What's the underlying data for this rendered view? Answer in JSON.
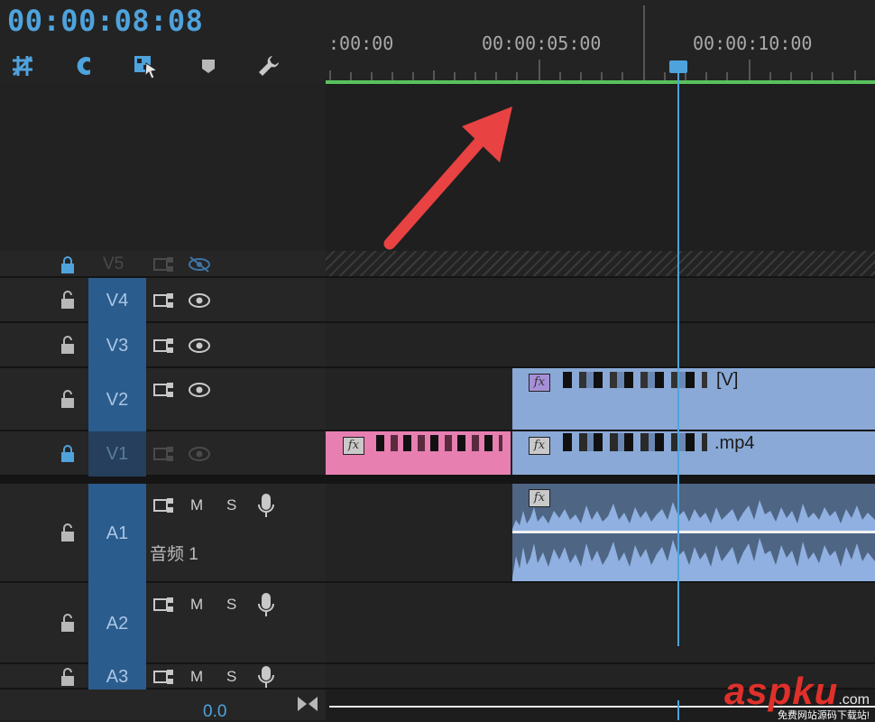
{
  "header": {
    "timecode": "00:00:08:08",
    "tools": [
      "snap-sequence-icon",
      "magnet-icon",
      "linked-selection-icon",
      "marker-icon",
      "wrench-icon"
    ]
  },
  "ruler": {
    "labels": [
      ":00:00",
      "00:00:05:00",
      "00:00:10:00"
    ]
  },
  "tracks": {
    "v5": {
      "label": "V5"
    },
    "v4": {
      "label": "V4"
    },
    "v3": {
      "label": "V3"
    },
    "v2": {
      "label": "V2"
    },
    "v1": {
      "label": "V1"
    },
    "a1": {
      "label": "A1",
      "name": "音频 1",
      "m": "M",
      "s": "S"
    },
    "a2": {
      "label": "A2",
      "m": "M",
      "s": "S"
    },
    "a3": {
      "label": "A3",
      "m": "M",
      "s": "S"
    }
  },
  "clips": {
    "v2_clip_suffix": "[V]",
    "v1_clip_suffix": ".mp4",
    "fx": "fx"
  },
  "footer": {
    "volume": "0.0"
  },
  "watermark": {
    "brand": "aspku",
    "tld": ".com",
    "tagline": "免费网站源码下载站!"
  },
  "colors": {
    "accent": "#4fa3dc",
    "workarea": "#58c25d",
    "video_clip": "#8aa9d6",
    "pink_clip": "#e77fb1",
    "target": "#2b5c8e"
  }
}
